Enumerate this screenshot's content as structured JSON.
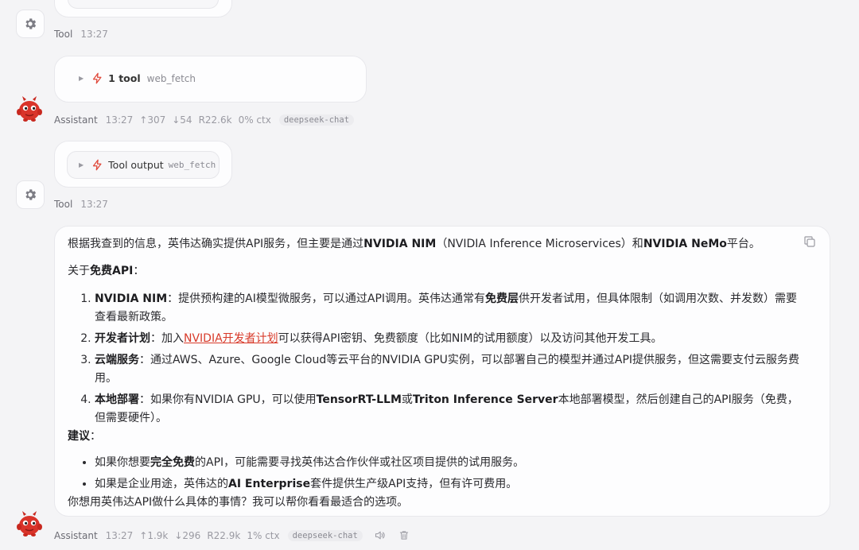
{
  "messages": {
    "tool1": {
      "role": "Tool",
      "time": "13:27"
    },
    "assistant1": {
      "role": "Assistant",
      "time": "13:27",
      "stats": [
        "↑307",
        "↓54",
        "R22.6k",
        "0% ctx"
      ],
      "model": "deepseek-chat",
      "tool_call": {
        "label": "1 tool",
        "name": "web_fetch"
      }
    },
    "tool2": {
      "role": "Tool",
      "time": "13:27",
      "tool_output": {
        "label": "Tool output",
        "name": "web_fetch"
      }
    },
    "assistant2": {
      "role": "Assistant",
      "time": "13:27",
      "stats": [
        "↑1.9k",
        "↓296",
        "R22.9k",
        "1% ctx"
      ],
      "model": "deepseek-chat",
      "content": {
        "intro_pre": "根据我查到的信息，英伟达确实提供API服务，但主要是通过",
        "intro_b1": "NVIDIA NIM",
        "intro_mid": "（NVIDIA Inference Microservices）和",
        "intro_b2": "NVIDIA NeMo",
        "intro_post": "平台。",
        "free_pre": "关于",
        "free_b": "免费API",
        "free_post": "：",
        "items": [
          {
            "b": "NVIDIA NIM",
            "t1": "：提供预构建的AI模型微服务，可以通过API调用。英伟达通常有",
            "b2": "免费层",
            "t2": "供开发者试用，但具体限制（如调用次数、并发数）需要查看最新政策。"
          },
          {
            "b": "开发者计划",
            "t1": "：加入",
            "link": "NVIDIA开发者计划",
            "t2": "可以获得API密钥、免费额度（比如NIM的试用额度）以及访问其他开发工具。"
          },
          {
            "b": "云端服务",
            "t1": "：通过AWS、Azure、Google Cloud等云平台的NVIDIA GPU实例，可以部署自己的模型并通过API提供服务，但这需要支付云服务费用。"
          },
          {
            "b": "本地部署",
            "t1": "：如果你有NVIDIA GPU，可以使用",
            "b2": "TensorRT-LLM",
            "t2": "或",
            "b3": "Triton Inference Server",
            "t3": "本地部署模型，然后创建自己的API服务（免费，但需要硬件）。"
          }
        ],
        "advice_b": "建议",
        "advice_post": "：",
        "bullets": [
          {
            "t1": "如果你想要",
            "b": "完全免费",
            "t2": "的API，可能需要寻找英伟达合作伙伴或社区项目提供的试用服务。"
          },
          {
            "t1": "如果是企业用途，英伟达的",
            "b": "AI Enterprise",
            "t2": "套件提供生产级API支持，但有许可费用。"
          }
        ],
        "closing": "你想用英伟达API做什么具体的事情？我可以帮你看看最适合的选项。"
      }
    }
  },
  "colors": {
    "accent": "#e0483a",
    "link": "#d83a2a",
    "background": "#f4f4f6"
  }
}
